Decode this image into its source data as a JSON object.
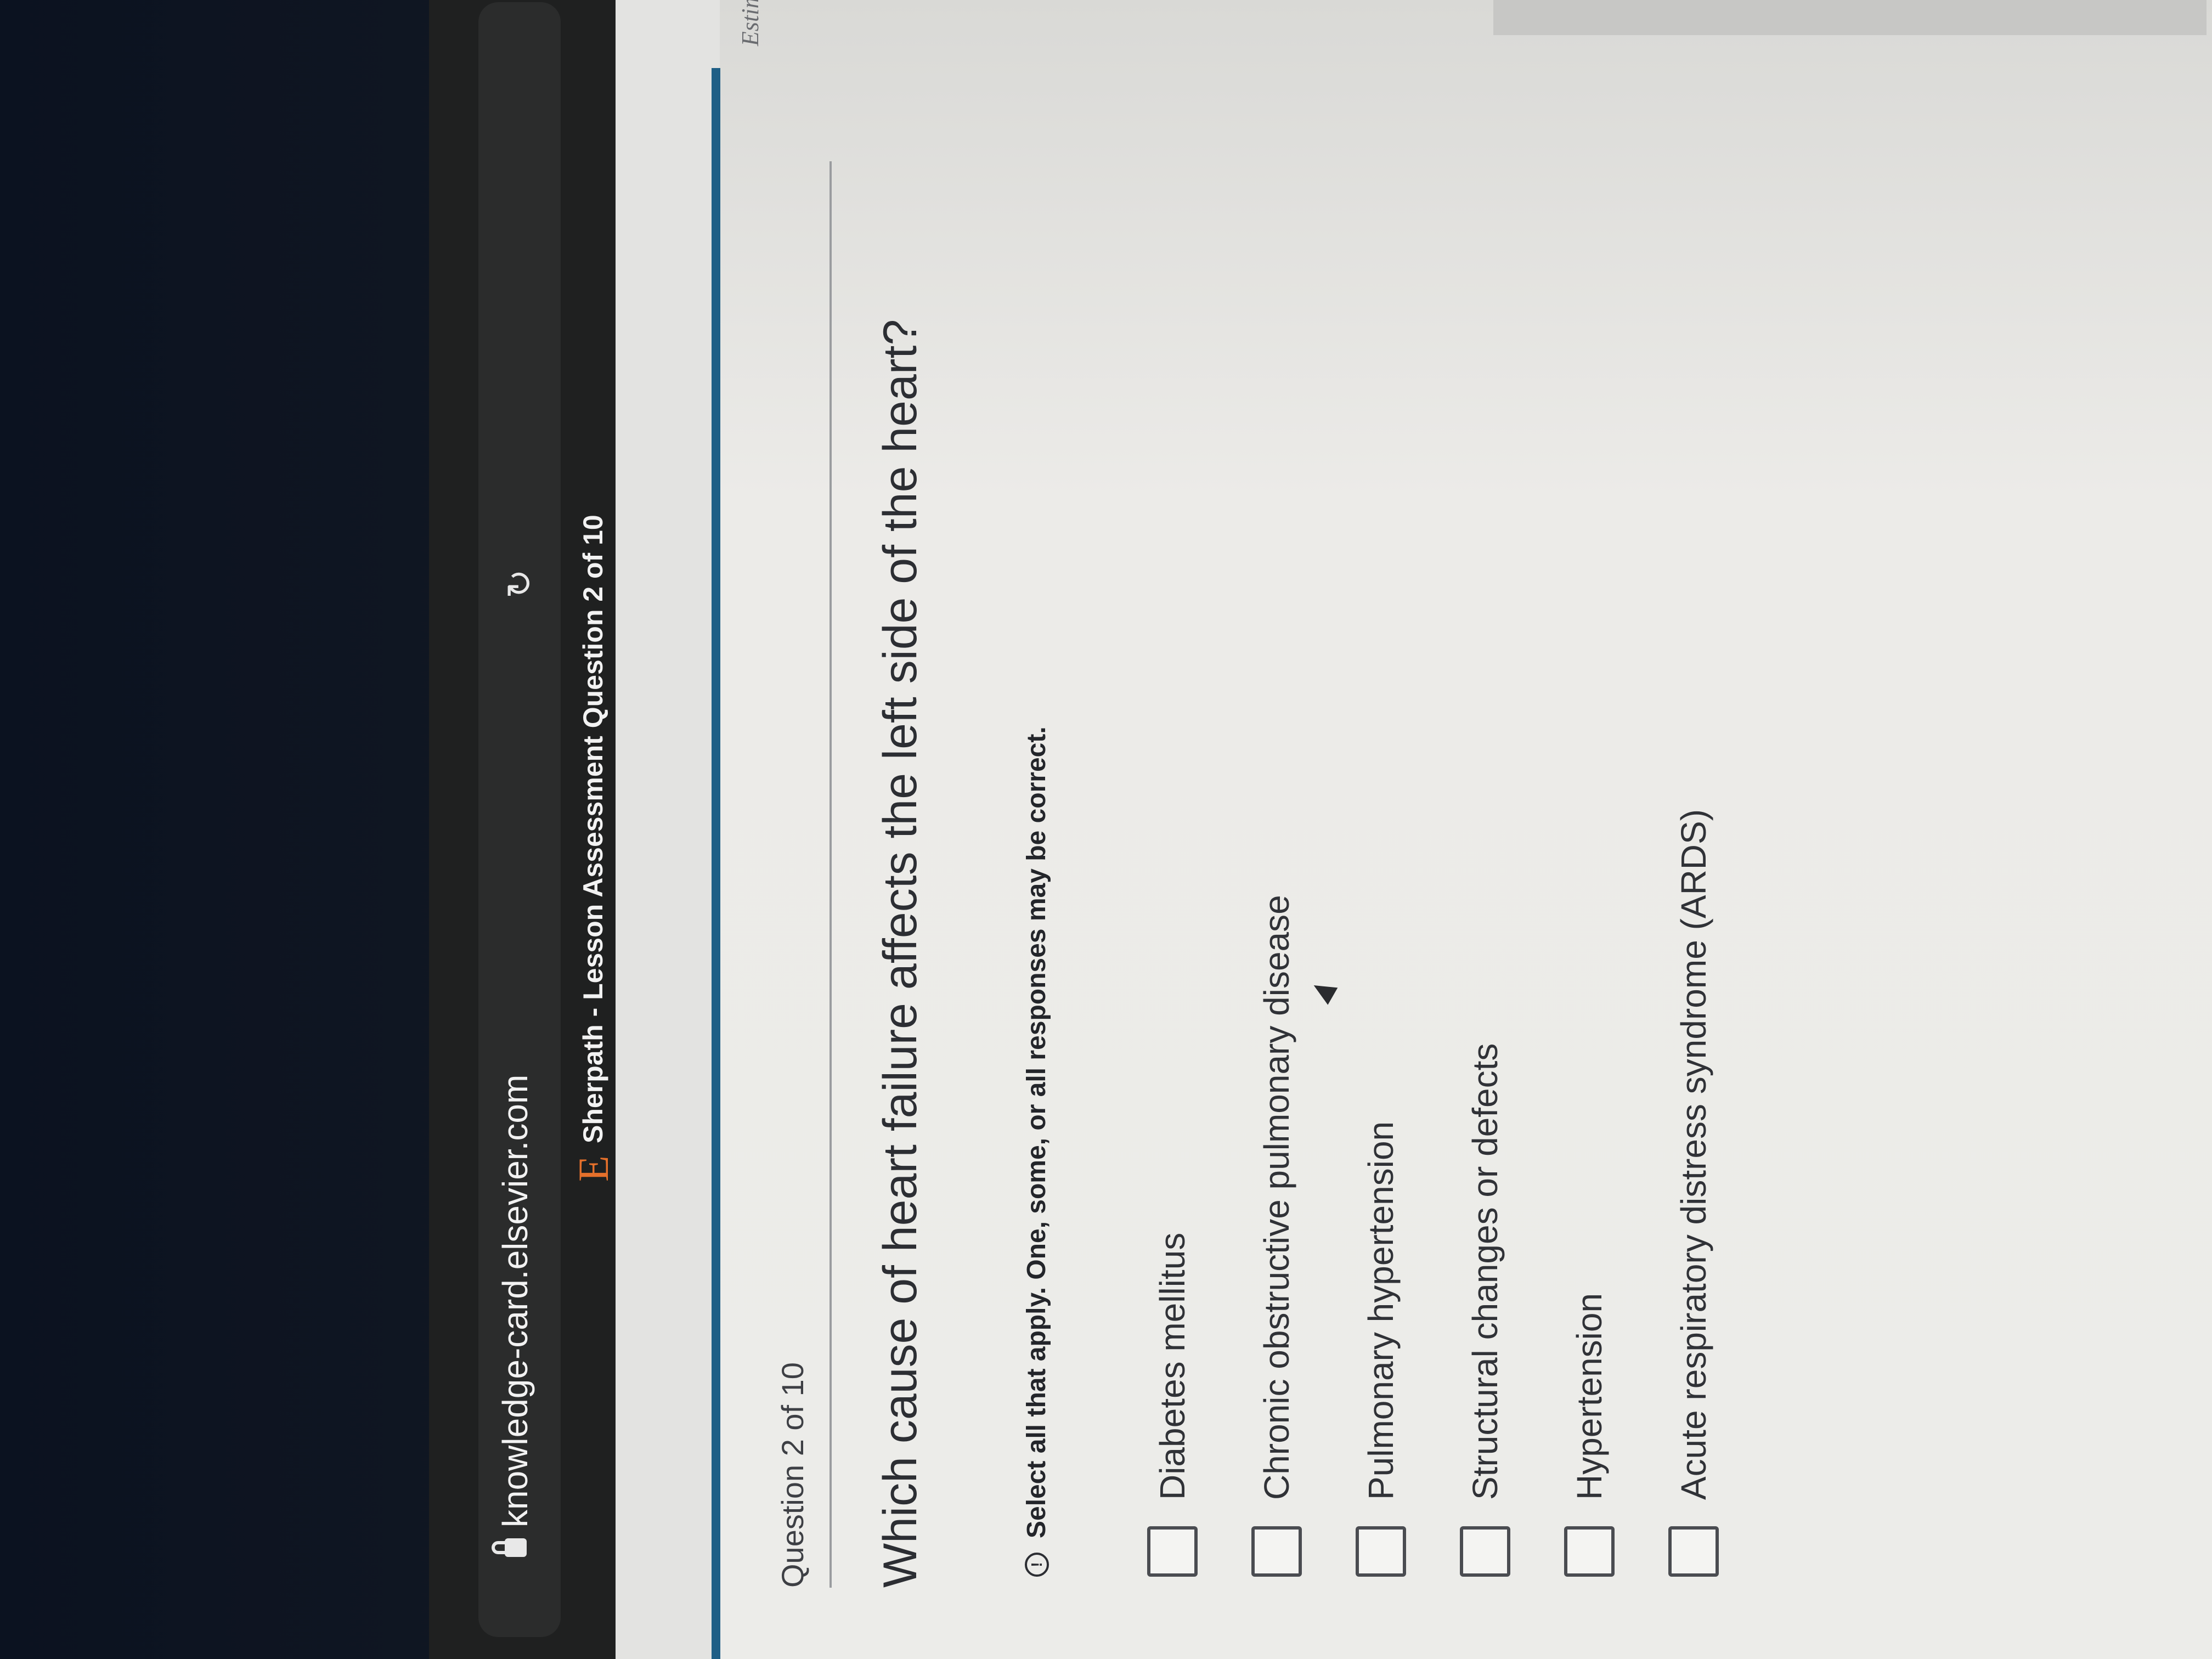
{
  "browser": {
    "url": "knowledge-card.elsevier.com",
    "tab_logo": "E",
    "tab_title": "Sherpath - Lesson Assessment Question 2 of 10",
    "reload_glyph": "↻"
  },
  "page": {
    "estimate_label": "Estimat",
    "question_counter": "Question 2 of 10",
    "question_text": "Which cause of heart failure affects the left side of the heart?",
    "hint_icon_glyph": "!",
    "hint_text": "Select all that apply. One, some, or all responses may be correct.",
    "options": [
      {
        "label": "Diabetes mellitus",
        "checked": false
      },
      {
        "label": "Chronic obstructive pulmonary disease",
        "checked": false
      },
      {
        "label": "Pulmonary hypertension",
        "checked": false
      },
      {
        "label": "Structural changes or defects",
        "checked": false
      },
      {
        "label": "Hypertension",
        "checked": false
      },
      {
        "label": "Acute respiratory distress syndrome (ARDS)",
        "checked": false
      }
    ]
  },
  "colors": {
    "accent_blue": "#1f5f86",
    "logo_orange": "#e5702b"
  }
}
